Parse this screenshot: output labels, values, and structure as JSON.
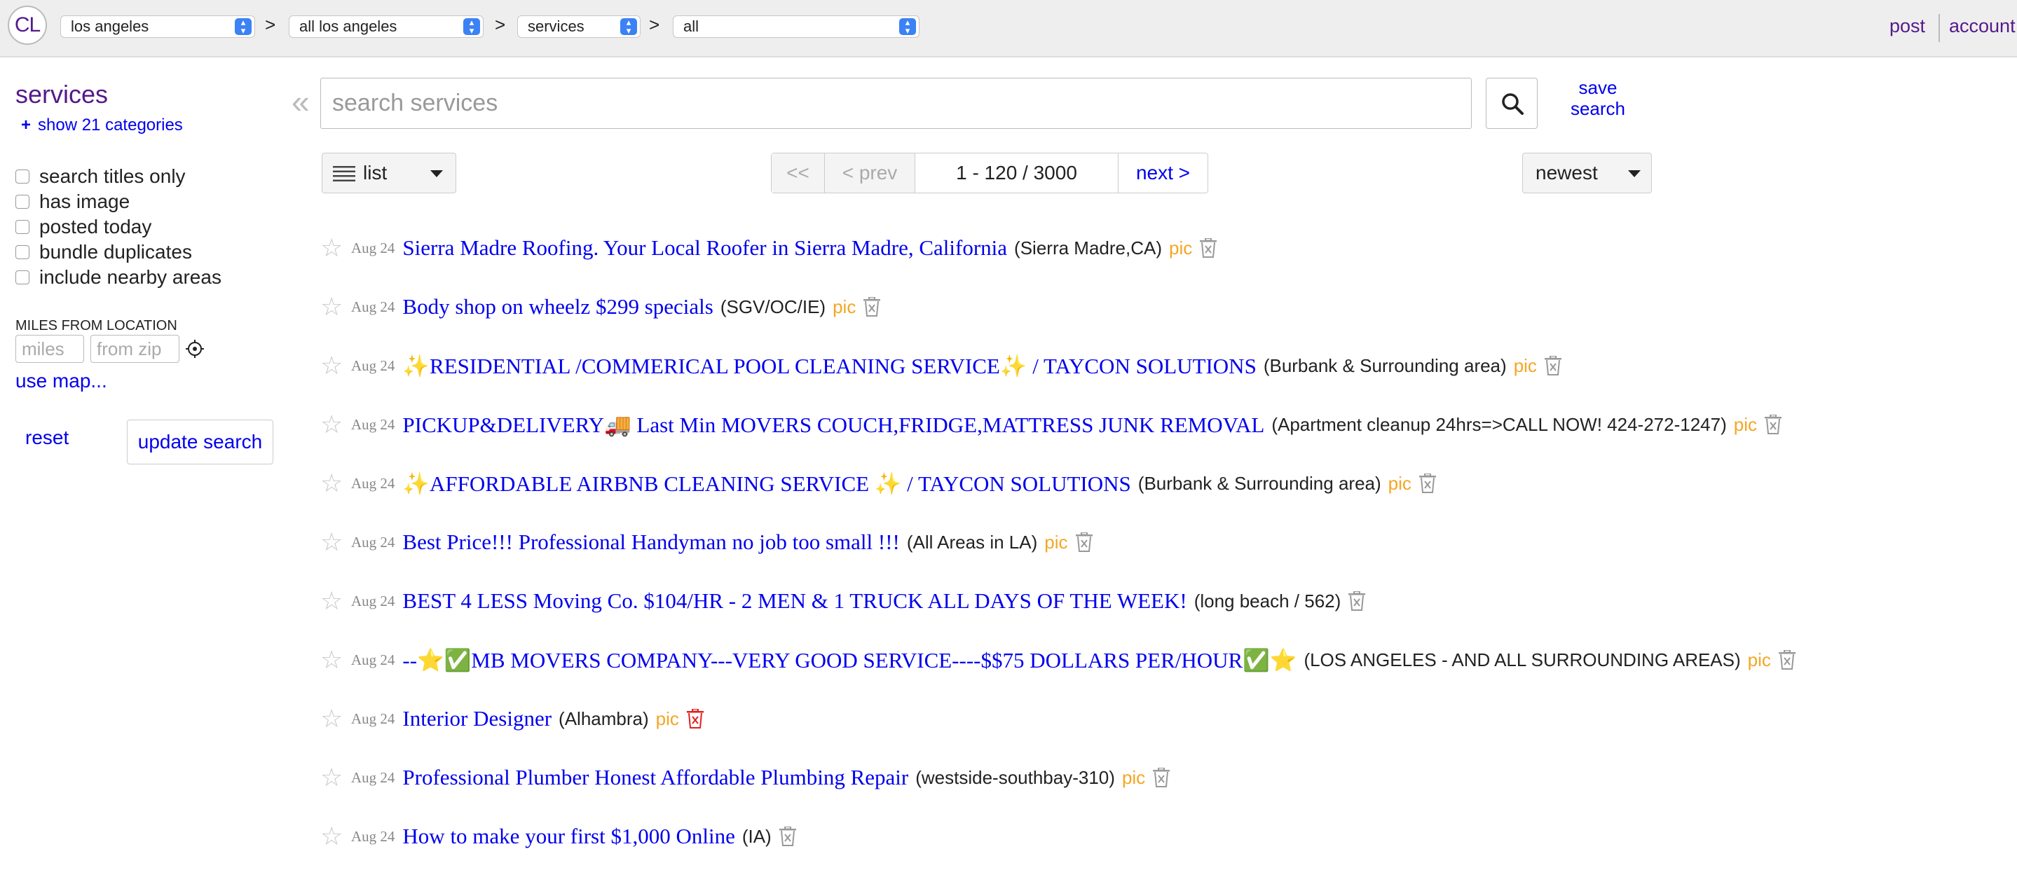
{
  "header": {
    "logo": "CL",
    "breadcrumbs": [
      {
        "label": "los angeles"
      },
      {
        "label": "all los angeles"
      },
      {
        "label": "services"
      },
      {
        "label": "all"
      }
    ],
    "separator": ">",
    "post_label": "post",
    "account_label": "account"
  },
  "sidebar": {
    "title": "services",
    "show_categories": "show 21 categories",
    "plus": "+",
    "filters": [
      {
        "label": "search titles only",
        "checked": false
      },
      {
        "label": "has image",
        "checked": false
      },
      {
        "label": "posted today",
        "checked": false
      },
      {
        "label": "bundle duplicates",
        "checked": false
      },
      {
        "label": "include nearby areas",
        "checked": false
      }
    ],
    "miles_label": "MILES FROM LOCATION",
    "miles_placeholder": "miles",
    "zip_placeholder": "from zip",
    "use_map": "use map...",
    "reset": "reset",
    "update_search": "update search"
  },
  "search": {
    "collapse_glyph": "«",
    "placeholder": "search services",
    "save_search": "save search"
  },
  "toolbar": {
    "view_mode": "list",
    "pager": {
      "first": "<<",
      "prev": "< prev",
      "range": "1 - 120 / 3000",
      "next": "next >"
    },
    "sort": "newest"
  },
  "results": [
    {
      "date": "Aug 24",
      "title": "Sierra Madre Roofing. Your Local Roofer in Sierra Madre, California",
      "hood": "(Sierra Madre,CA)",
      "pic": "pic",
      "trash_color": "#999999"
    },
    {
      "date": "Aug 24",
      "title": "Body shop on wheelz $299 specials",
      "hood": "(SGV/OC/IE)",
      "pic": "pic",
      "trash_color": "#999999"
    },
    {
      "date": "Aug 24",
      "title": "✨RESIDENTIAL /COMMERICAL POOL CLEANING SERVICE✨ / TAYCON SOLUTIONS",
      "hood": "(Burbank & Surrounding area)",
      "pic": "pic",
      "trash_color": "#999999"
    },
    {
      "date": "Aug 24",
      "title": "PICKUP&DELIVERY🚚 Last Min MOVERS COUCH,FRIDGE,MATTRESS JUNK REMOVAL",
      "hood": "(Apartment cleanup 24hrs=>CALL NOW! 424-272-1247)",
      "pic": "pic",
      "trash_color": "#999999"
    },
    {
      "date": "Aug 24",
      "title": "✨AFFORDABLE AIRBNB CLEANING SERVICE ✨ / TAYCON SOLUTIONS",
      "hood": "(Burbank & Surrounding area)",
      "pic": "pic",
      "trash_color": "#999999"
    },
    {
      "date": "Aug 24",
      "title": "Best Price!!! Professional Handyman no job too small !!!",
      "hood": "(All Areas in LA)",
      "pic": "pic",
      "trash_color": "#999999"
    },
    {
      "date": "Aug 24",
      "title": "BEST 4 LESS Moving Co. $104/HR - 2 MEN & 1 TRUCK ALL DAYS OF THE WEEK!",
      "hood": "(long beach / 562)",
      "pic": "",
      "trash_color": "#999999"
    },
    {
      "date": "Aug 24",
      "title": "--⭐✅MB MOVERS COMPANY---VERY GOOD SERVICE----$$75 DOLLARS PER/HOUR✅⭐",
      "hood": "(LOS ANGELES - AND ALL SURROUNDING AREAS)",
      "pic": "pic",
      "trash_color": "#999999"
    },
    {
      "date": "Aug 24",
      "title": "Interior Designer",
      "hood": "(Alhambra)",
      "pic": "pic",
      "trash_color": "#e02020"
    },
    {
      "date": "Aug 24",
      "title": "Professional Plumber Honest Affordable Plumbing Repair",
      "hood": "(westside-southbay-310)",
      "pic": "pic",
      "trash_color": "#999999"
    },
    {
      "date": "Aug 24",
      "title": "How to make your first $1,000 Online",
      "hood": "(IA)",
      "pic": "",
      "trash_color": "#999999"
    }
  ],
  "colors": {
    "link": "#0000ee",
    "visited": "#551a8b",
    "pic": "#f5a623",
    "topbar_bg": "#eeeeee"
  }
}
